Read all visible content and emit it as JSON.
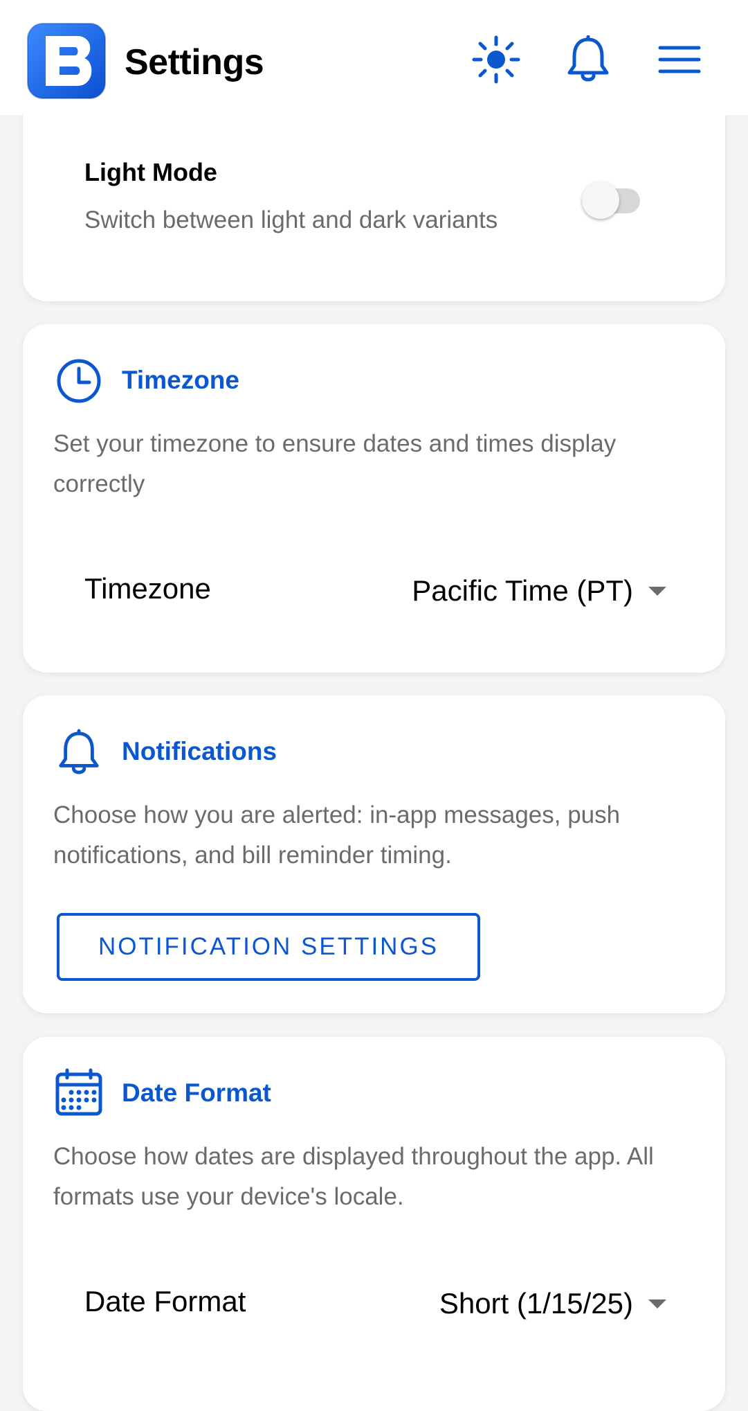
{
  "header": {
    "logo_letter": "B",
    "title": "Settings",
    "icons": {
      "theme": "sun-icon",
      "notifications": "bell-icon",
      "menu": "hamburger-menu-icon"
    }
  },
  "appearance": {
    "label": "Light Mode",
    "description": "Switch between light and dark variants",
    "toggle_on": false
  },
  "timezone": {
    "icon": "clock-icon",
    "title": "Timezone",
    "description": "Set your timezone to ensure dates and times display correctly",
    "select_label": "Timezone",
    "selected": "Pacific Time (PT)"
  },
  "notifications": {
    "icon": "bell-icon",
    "title": "Notifications",
    "description": "Choose how you are alerted: in-app messages, push notifications, and bill reminder timing.",
    "button_label": "NOTIFICATION SETTINGS"
  },
  "date_format": {
    "icon": "calendar-icon",
    "title": "Date Format",
    "description": "Choose how dates are displayed throughout the app. All formats use your device's locale.",
    "select_label": "Date Format",
    "selected": "Short (1/15/25)"
  },
  "colors": {
    "accent": "#0b57d0",
    "muted_text": "#6b6b6b",
    "background": "#f3f4f6",
    "card": "#ffffff"
  }
}
